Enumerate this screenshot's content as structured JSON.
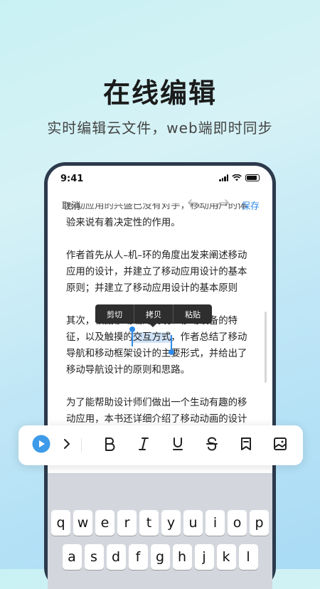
{
  "hero": {
    "title": "在线编辑",
    "subtitle": "实时编辑云文件，web端即时同步"
  },
  "status_bar": {
    "time": "9:41"
  },
  "toolbar": {
    "cancel": "取消",
    "save": "保存"
  },
  "document": {
    "para0_cut": "移动应用的兴盛已没有对手，移动用户的体验来说有着决定性的作用。",
    "para0_top": "验来说有着决定性的作用。",
    "para1_line1": "作者首先从人–机–环的角度出发来阐述移动",
    "para1_line2": "应用的设计，并建立了移动应用设计的基本",
    "para1_line3": "原则；并建立了移动应用设计的基本原则",
    "para2_line1": "其次，根据移动端的情境、移动设备的特",
    "para2_line2_a": "征，以及触摸的",
    "para2_line2_sel": "交互方式",
    "para2_line2_b": "，作者总结了移动",
    "para2_line3": "导航和移动框架设计的主要形式，并给出了",
    "para2_line4": "移动导航设计的原则和思路。",
    "para3_line1": "为了能帮助设计师们做出一个生动有趣的移",
    "para3_line2": "动应用，本书还详细介绍了移动动画的设计"
  },
  "context_menu": {
    "cut": "剪切",
    "copy": "拷贝",
    "paste": "粘贴"
  },
  "keyboard": {
    "row1": [
      "q",
      "w",
      "e",
      "r",
      "t",
      "y",
      "u",
      "i",
      "o",
      "p"
    ],
    "row2": [
      "a",
      "s",
      "d",
      "f",
      "g",
      "h",
      "j",
      "k",
      "l"
    ]
  },
  "colors": {
    "accent": "#2f8be8",
    "play": "#3d9be9"
  },
  "format_bar": {
    "items": [
      "play-icon",
      "chevron-right-icon",
      "bold-icon",
      "italic-icon",
      "underline-icon",
      "strikethrough-icon",
      "bookmark-icon",
      "image-icon"
    ]
  }
}
